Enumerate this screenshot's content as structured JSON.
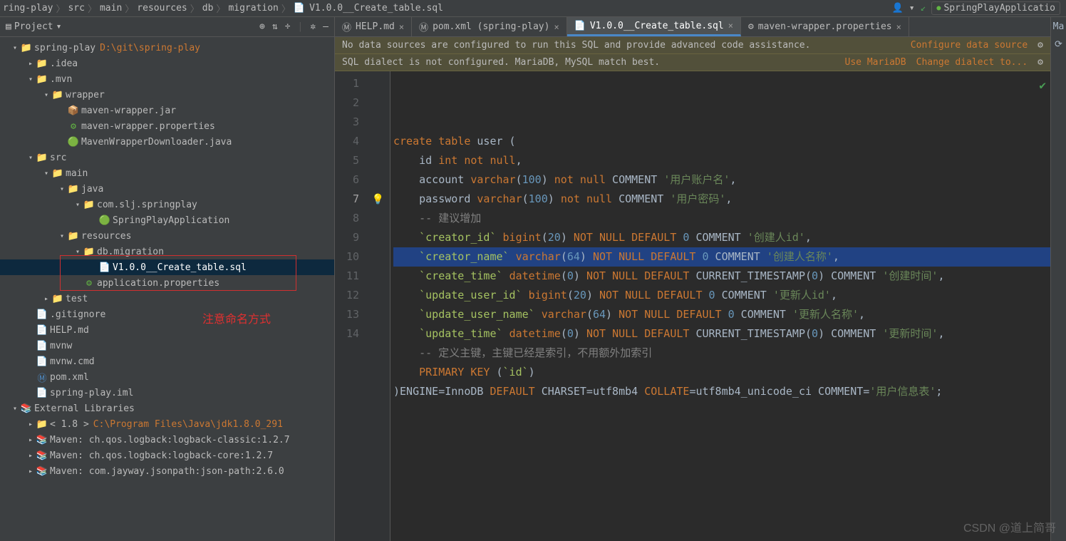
{
  "breadcrumb": {
    "parts": [
      "ring-play",
      "src",
      "main",
      "resources",
      "db",
      "migration",
      "V1.0.0__Create_table.sql"
    ],
    "file_icon": "sql-icon"
  },
  "run_config": {
    "name": "SpringPlayApplicatio"
  },
  "project": {
    "title": "Project",
    "tree": [
      {
        "depth": 0,
        "caret": "down",
        "icon": "root-folder",
        "label": "spring-play",
        "suffix": "D:\\git\\spring-play",
        "suffix_color": "path-yellow"
      },
      {
        "depth": 1,
        "caret": "right",
        "icon": "folder",
        "label": ".idea"
      },
      {
        "depth": 1,
        "caret": "down",
        "icon": "folder",
        "label": ".mvn"
      },
      {
        "depth": 2,
        "caret": "down",
        "icon": "folder",
        "label": "wrapper"
      },
      {
        "depth": 3,
        "caret": "none",
        "icon": "jar",
        "label": "maven-wrapper.jar"
      },
      {
        "depth": 3,
        "caret": "none",
        "icon": "props",
        "label": "maven-wrapper.properties"
      },
      {
        "depth": 3,
        "caret": "none",
        "icon": "java",
        "label": "MavenWrapperDownloader.java"
      },
      {
        "depth": 1,
        "caret": "down",
        "icon": "folder",
        "label": "src"
      },
      {
        "depth": 2,
        "caret": "down",
        "icon": "folder",
        "label": "main"
      },
      {
        "depth": 3,
        "caret": "down",
        "icon": "pkg-folder",
        "label": "java"
      },
      {
        "depth": 4,
        "caret": "down",
        "icon": "folder",
        "label": "com.slj.springplay"
      },
      {
        "depth": 5,
        "caret": "none",
        "icon": "java",
        "label": "SpringPlayApplication"
      },
      {
        "depth": 3,
        "caret": "down",
        "icon": "rsrc-folder",
        "label": "resources"
      },
      {
        "depth": 4,
        "caret": "down",
        "icon": "folder",
        "label": "db.migration"
      },
      {
        "depth": 5,
        "caret": "none",
        "icon": "sql",
        "label": "V1.0.0__Create_table.sql",
        "selected": true
      },
      {
        "depth": 4,
        "caret": "none",
        "icon": "props",
        "label": "application.properties"
      },
      {
        "depth": 2,
        "caret": "right",
        "icon": "folder",
        "label": "test"
      },
      {
        "depth": 1,
        "caret": "none",
        "icon": "file",
        "label": ".gitignore"
      },
      {
        "depth": 1,
        "caret": "none",
        "icon": "md",
        "label": "HELP.md"
      },
      {
        "depth": 1,
        "caret": "none",
        "icon": "file",
        "label": "mvnw"
      },
      {
        "depth": 1,
        "caret": "none",
        "icon": "file",
        "label": "mvnw.cmd"
      },
      {
        "depth": 1,
        "caret": "none",
        "icon": "xml",
        "label": "pom.xml"
      },
      {
        "depth": 1,
        "caret": "none",
        "icon": "file",
        "label": "spring-play.iml"
      },
      {
        "depth": 0,
        "caret": "down",
        "icon": "lib",
        "label": "External Libraries"
      },
      {
        "depth": 1,
        "caret": "right",
        "icon": "folder",
        "label": "< 1.8 >",
        "suffix": "C:\\Program Files\\Java\\jdk1.8.0_291",
        "suffix_color": "path-yellow"
      },
      {
        "depth": 1,
        "caret": "right",
        "icon": "lib",
        "label": "Maven: ch.qos.logback:logback-classic:1.2.7"
      },
      {
        "depth": 1,
        "caret": "right",
        "icon": "lib",
        "label": "Maven: ch.qos.logback:logback-core:1.2.7"
      },
      {
        "depth": 1,
        "caret": "right",
        "icon": "lib",
        "label": "Maven: com.jayway.jsonpath:json-path:2.6.0"
      }
    ],
    "note": "注意命名方式"
  },
  "editor": {
    "tabs": [
      {
        "icon": "md",
        "label": "HELP.md"
      },
      {
        "icon": "xml",
        "label": "pom.xml (spring-play)"
      },
      {
        "icon": "sql",
        "label": "V1.0.0__Create_table.sql",
        "active": true
      },
      {
        "icon": "props",
        "label": "maven-wrapper.properties"
      }
    ],
    "right_tab": "Ma",
    "banners": [
      {
        "text": "No data sources are configured to run this SQL and provide advanced code assistance.",
        "actions": [
          {
            "label": "Configure data source",
            "type": "link"
          },
          {
            "label": "⚙",
            "type": "gear"
          }
        ]
      },
      {
        "text": "SQL dialect is not configured. MariaDB, MySQL match best.",
        "actions": [
          {
            "label": "Use MariaDB",
            "type": "link"
          },
          {
            "label": "Change dialect to...",
            "type": "link"
          },
          {
            "label": "⚙",
            "type": "gear"
          }
        ]
      }
    ],
    "bulb_line": 7,
    "lines": [
      {
        "n": 1,
        "tokens": [
          [
            "kw",
            "create"
          ],
          [
            "ident",
            " "
          ],
          [
            "kw",
            "table"
          ],
          [
            "ident",
            " user ("
          ]
        ]
      },
      {
        "n": 2,
        "tokens": [
          [
            "ident",
            "    id "
          ],
          [
            "kw",
            "int"
          ],
          [
            "ident",
            " "
          ],
          [
            "kw",
            "not"
          ],
          [
            "ident",
            " "
          ],
          [
            "kw",
            "null"
          ],
          [
            "punct",
            ","
          ]
        ]
      },
      {
        "n": 3,
        "tokens": [
          [
            "ident",
            "    account "
          ],
          [
            "kw",
            "varchar"
          ],
          [
            "punct",
            "("
          ],
          [
            "num",
            "100"
          ],
          [
            "punct",
            ") "
          ],
          [
            "kw",
            "not"
          ],
          [
            "ident",
            " "
          ],
          [
            "kw",
            "null"
          ],
          [
            "ident",
            " COMMENT "
          ],
          [
            "str",
            "'用户账户名'"
          ],
          [
            "punct",
            ","
          ]
        ]
      },
      {
        "n": 4,
        "tokens": [
          [
            "ident",
            "    password "
          ],
          [
            "kw",
            "varchar"
          ],
          [
            "punct",
            "("
          ],
          [
            "num",
            "100"
          ],
          [
            "punct",
            ") "
          ],
          [
            "kw",
            "not"
          ],
          [
            "ident",
            " "
          ],
          [
            "kw",
            "null"
          ],
          [
            "ident",
            " COMMENT "
          ],
          [
            "str",
            "'用户密码'"
          ],
          [
            "punct",
            ","
          ]
        ]
      },
      {
        "n": 5,
        "tokens": [
          [
            "cmt",
            "    -- 建议增加"
          ]
        ]
      },
      {
        "n": 6,
        "tokens": [
          [
            "ident",
            "    "
          ],
          [
            "bq",
            "`creator_id`"
          ],
          [
            "ident",
            " "
          ],
          [
            "kw",
            "bigint"
          ],
          [
            "punct",
            "("
          ],
          [
            "num",
            "20"
          ],
          [
            "punct",
            ") "
          ],
          [
            "kw",
            "NOT"
          ],
          [
            "ident",
            " "
          ],
          [
            "kw",
            "NULL"
          ],
          [
            "ident",
            " "
          ],
          [
            "kw",
            "DEFAULT"
          ],
          [
            "ident",
            " "
          ],
          [
            "num",
            "0"
          ],
          [
            "ident",
            " COMMENT "
          ],
          [
            "str",
            "'创建人id'"
          ],
          [
            "punct",
            ","
          ]
        ]
      },
      {
        "n": 7,
        "current": true,
        "tokens": [
          [
            "ident",
            "    "
          ],
          [
            "bq",
            "`creator_name`"
          ],
          [
            "ident",
            " "
          ],
          [
            "kw",
            "varchar"
          ],
          [
            "punct",
            "("
          ],
          [
            "num",
            "64"
          ],
          [
            "punct",
            ") "
          ],
          [
            "kw",
            "NOT"
          ],
          [
            "ident",
            " "
          ],
          [
            "kw",
            "NULL"
          ],
          [
            "ident",
            " "
          ],
          [
            "kw",
            "DEFAULT"
          ],
          [
            "ident",
            " "
          ],
          [
            "num",
            "0"
          ],
          [
            "ident",
            " COMMENT "
          ],
          [
            "str",
            "'创建人名称'"
          ],
          [
            "punct",
            ","
          ]
        ]
      },
      {
        "n": 8,
        "tokens": [
          [
            "ident",
            "    "
          ],
          [
            "bq",
            "`create_time`"
          ],
          [
            "ident",
            " "
          ],
          [
            "kw",
            "datetime"
          ],
          [
            "punct",
            "("
          ],
          [
            "num",
            "0"
          ],
          [
            "punct",
            ") "
          ],
          [
            "kw",
            "NOT"
          ],
          [
            "ident",
            " "
          ],
          [
            "kw",
            "NULL"
          ],
          [
            "ident",
            " "
          ],
          [
            "kw",
            "DEFAULT"
          ],
          [
            "ident",
            " CURRENT_TIMESTAMP"
          ],
          [
            "punct",
            "("
          ],
          [
            "num",
            "0"
          ],
          [
            "punct",
            ") "
          ],
          [
            "ident",
            "COMMENT "
          ],
          [
            "str",
            "'创建时间'"
          ],
          [
            "punct",
            ","
          ]
        ]
      },
      {
        "n": 9,
        "tokens": [
          [
            "ident",
            "    "
          ],
          [
            "bq",
            "`update_user_id`"
          ],
          [
            "ident",
            " "
          ],
          [
            "kw",
            "bigint"
          ],
          [
            "punct",
            "("
          ],
          [
            "num",
            "20"
          ],
          [
            "punct",
            ") "
          ],
          [
            "kw",
            "NOT"
          ],
          [
            "ident",
            " "
          ],
          [
            "kw",
            "NULL"
          ],
          [
            "ident",
            " "
          ],
          [
            "kw",
            "DEFAULT"
          ],
          [
            "ident",
            " "
          ],
          [
            "num",
            "0"
          ],
          [
            "ident",
            " COMMENT "
          ],
          [
            "str",
            "'更新人id'"
          ],
          [
            "punct",
            ","
          ]
        ]
      },
      {
        "n": 10,
        "tokens": [
          [
            "ident",
            "    "
          ],
          [
            "bq",
            "`update_user_name`"
          ],
          [
            "ident",
            " "
          ],
          [
            "kw",
            "varchar"
          ],
          [
            "punct",
            "("
          ],
          [
            "num",
            "64"
          ],
          [
            "punct",
            ") "
          ],
          [
            "kw",
            "NOT"
          ],
          [
            "ident",
            " "
          ],
          [
            "kw",
            "NULL"
          ],
          [
            "ident",
            " "
          ],
          [
            "kw",
            "DEFAULT"
          ],
          [
            "ident",
            " "
          ],
          [
            "num",
            "0"
          ],
          [
            "ident",
            " COMMENT "
          ],
          [
            "str",
            "'更新人名称'"
          ],
          [
            "punct",
            ","
          ]
        ]
      },
      {
        "n": 11,
        "tokens": [
          [
            "ident",
            "    "
          ],
          [
            "bq",
            "`update_time`"
          ],
          [
            "ident",
            " "
          ],
          [
            "kw",
            "datetime"
          ],
          [
            "punct",
            "("
          ],
          [
            "num",
            "0"
          ],
          [
            "punct",
            ") "
          ],
          [
            "kw",
            "NOT"
          ],
          [
            "ident",
            " "
          ],
          [
            "kw",
            "NULL"
          ],
          [
            "ident",
            " "
          ],
          [
            "kw",
            "DEFAULT"
          ],
          [
            "ident",
            " CURRENT_TIMESTAMP"
          ],
          [
            "punct",
            "("
          ],
          [
            "num",
            "0"
          ],
          [
            "punct",
            ") "
          ],
          [
            "ident",
            "COMMENT "
          ],
          [
            "str",
            "'更新时间'"
          ],
          [
            "punct",
            ","
          ]
        ]
      },
      {
        "n": 12,
        "tokens": [
          [
            "cmt",
            "    -- 定义主键，主键已经是索引，不用额外加索引"
          ]
        ]
      },
      {
        "n": 13,
        "tokens": [
          [
            "ident",
            "    "
          ],
          [
            "kw",
            "PRIMARY KEY"
          ],
          [
            "ident",
            " ("
          ],
          [
            "bq",
            "`id`"
          ],
          [
            "ident",
            ")"
          ]
        ]
      },
      {
        "n": 14,
        "tokens": [
          [
            "ident",
            ")ENGINE=InnoDB "
          ],
          [
            "kw",
            "DEFAULT"
          ],
          [
            "ident",
            " CHARSET=utf8mb4 "
          ],
          [
            "kw",
            "COLLATE"
          ],
          [
            "ident",
            "=utf8mb4_unicode_ci COMMENT="
          ],
          [
            "str",
            "'用户信息表'"
          ],
          [
            "punct",
            ";"
          ]
        ]
      }
    ]
  },
  "watermark": "CSDN @道上简哥"
}
